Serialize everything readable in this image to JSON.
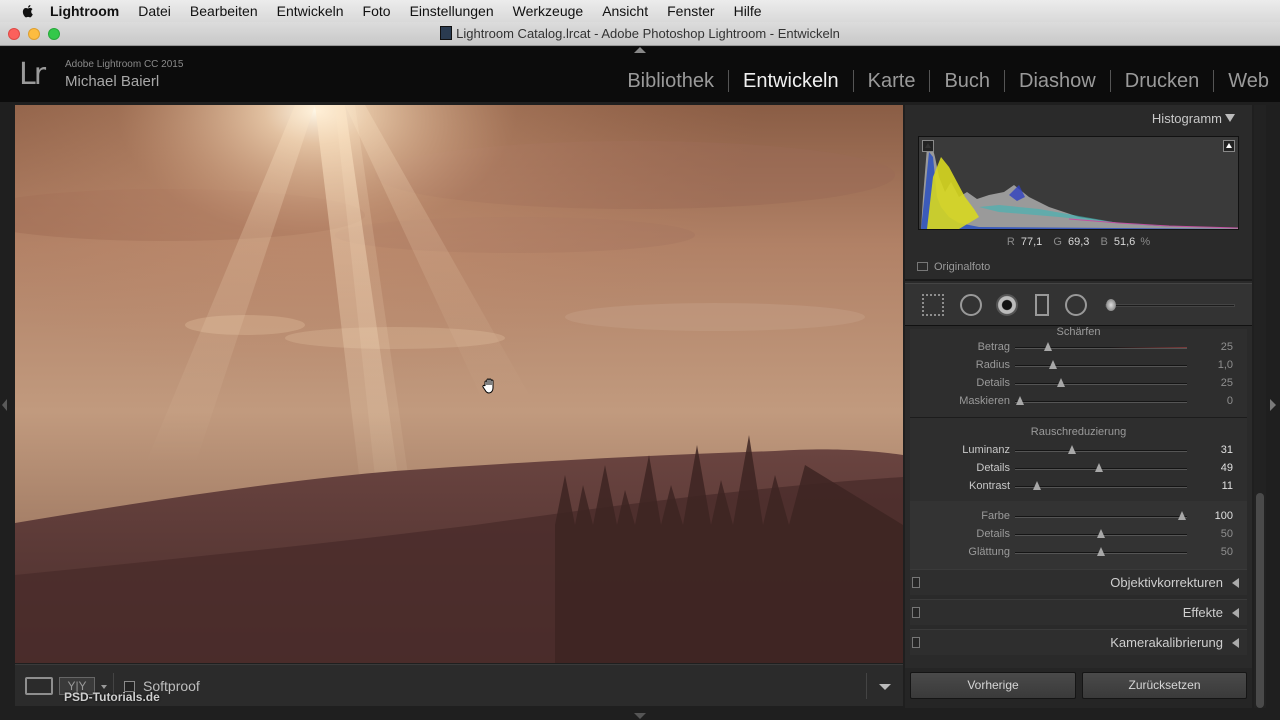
{
  "menubar": {
    "app": "Lightroom",
    "items": [
      "Datei",
      "Bearbeiten",
      "Entwickeln",
      "Foto",
      "Einstellungen",
      "Werkzeuge",
      "Ansicht",
      "Fenster",
      "Hilfe"
    ]
  },
  "window": {
    "title": "Lightroom Catalog.lrcat - Adobe Photoshop Lightroom - Entwickeln"
  },
  "identity": {
    "logo": "Lr",
    "product": "Adobe Lightroom CC 2015",
    "user": "Michael Baierl"
  },
  "modules": {
    "items": [
      "Bibliothek",
      "Entwickeln",
      "Karte",
      "Buch",
      "Diashow",
      "Drucken",
      "Web"
    ],
    "active": "Entwickeln"
  },
  "toolbar": {
    "yy_label": "Y|Y",
    "softproof_label": "Softproof",
    "softproof_checked": false,
    "watermark": "PSD-Tutorials.de"
  },
  "histogram": {
    "title": "Histogramm",
    "r_label": "R",
    "r_value": "77,1",
    "g_label": "G",
    "g_value": "69,3",
    "b_label": "B",
    "b_value": "51,6",
    "unit": "%",
    "original_label": "Originalfoto"
  },
  "detail": {
    "sharpen_title": "Schärfen",
    "sharpen": [
      {
        "label": "Betrag",
        "value": "25",
        "pos": 0.19
      },
      {
        "label": "Radius",
        "value": "1,0",
        "pos": 0.22
      },
      {
        "label": "Details",
        "value": "25",
        "pos": 0.27
      },
      {
        "label": "Maskieren",
        "value": "0",
        "pos": 0.03
      }
    ],
    "noise_title": "Rauschreduzierung",
    "luminance": [
      {
        "label": "Luminanz",
        "value": "31",
        "pos": 0.33
      },
      {
        "label": "Details",
        "value": "49",
        "pos": 0.49
      },
      {
        "label": "Kontrast",
        "value": "11",
        "pos": 0.13
      }
    ],
    "color": [
      {
        "label": "Farbe",
        "value": "100",
        "pos": 0.97
      },
      {
        "label": "Details",
        "value": "50",
        "pos": 0.5
      },
      {
        "label": "Glättung",
        "value": "50",
        "pos": 0.5
      }
    ]
  },
  "panels": [
    "Objektivkorrekturen",
    "Effekte",
    "Kamerakalibrierung"
  ],
  "buttons": {
    "previous": "Vorherige",
    "reset": "Zurücksetzen"
  },
  "colors": {
    "accent": "#f0f0f0",
    "panel_bg": "#2a2a2a"
  }
}
